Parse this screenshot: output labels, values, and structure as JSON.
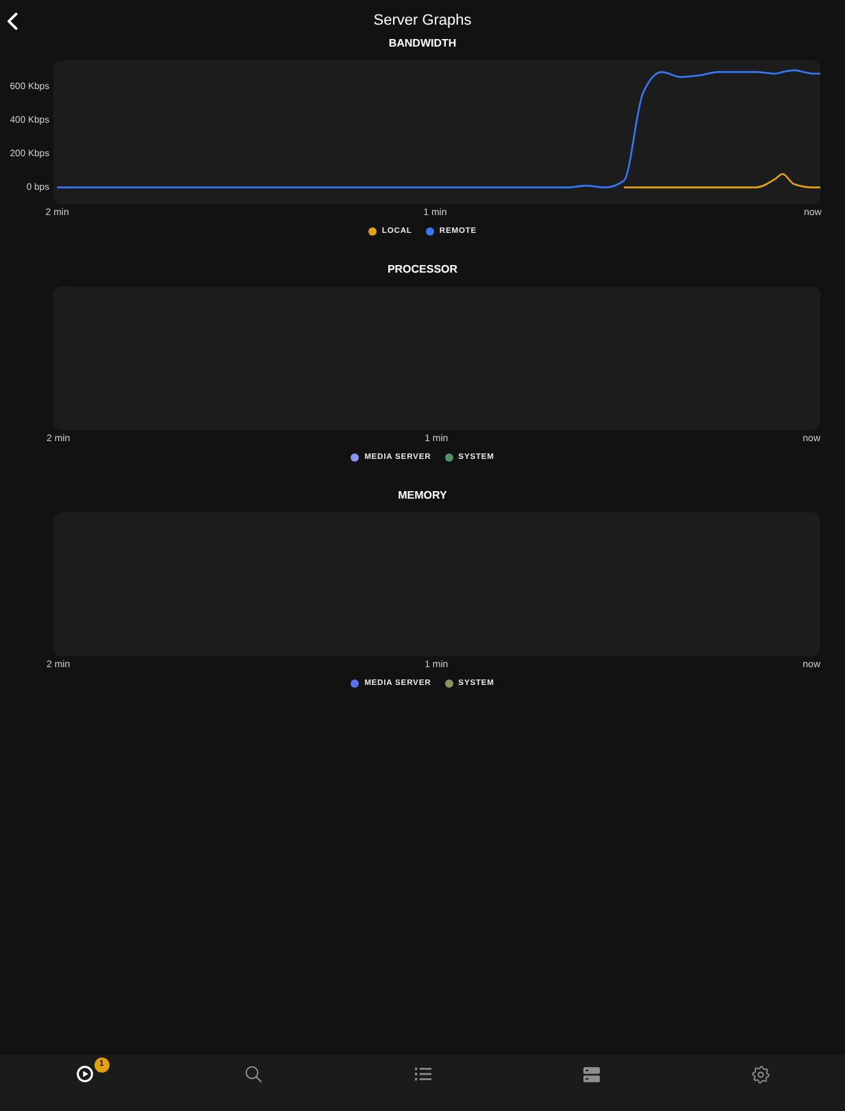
{
  "header": {
    "title": "Server Graphs"
  },
  "sections": [
    {
      "kind": "line_chart",
      "title": "BANDWIDTH",
      "chart_data": {
        "type": "line",
        "x": [
          2,
          1.95,
          1.9,
          1.85,
          1.8,
          1.75,
          1.7,
          1.65,
          1.6,
          1.55,
          1.5,
          1.45,
          1.4,
          1.35,
          1.3,
          1.25,
          1.2,
          1.15,
          1.1,
          1.05,
          1,
          0.95,
          0.9,
          0.85,
          0.8,
          0.75,
          0.7,
          0.65,
          0.6,
          0.55,
          0.5,
          0.45,
          0.4,
          0.35,
          0.3,
          0.25,
          0.2,
          0.15,
          0.1,
          0.08,
          0.05,
          0,
          -0.02
        ],
        "xlim": [
          2.01,
          -0.02
        ],
        "ylim": [
          -100,
          760
        ],
        "xticks": [
          {
            "value": 2,
            "label": "2 min"
          },
          {
            "value": 1,
            "label": "1 min"
          },
          {
            "value": 0,
            "label": "now"
          }
        ],
        "yticks": [
          {
            "value": 0,
            "label": "0 bps"
          },
          {
            "value": 200,
            "label": "200 Kbps"
          },
          {
            "value": 400,
            "label": "400 Kbps"
          },
          {
            "value": 600,
            "label": "600 Kbps"
          }
        ],
        "legend": "bottom",
        "series": [
          {
            "name": "LOCAL",
            "color": "#e5a00d",
            "values": [
              null,
              null,
              null,
              null,
              null,
              null,
              null,
              null,
              null,
              null,
              null,
              null,
              null,
              null,
              null,
              null,
              null,
              null,
              null,
              null,
              null,
              null,
              null,
              null,
              null,
              null,
              null,
              null,
              null,
              null,
              0,
              0,
              0,
              0,
              0,
              0,
              0,
              0,
              50,
              80,
              20,
              0,
              0
            ]
          },
          {
            "name": "REMOTE",
            "color": "#3478f6",
            "values": [
              0,
              0,
              0,
              0,
              0,
              0,
              0,
              0,
              0,
              0,
              0,
              0,
              0,
              0,
              0,
              0,
              0,
              0,
              0,
              0,
              0,
              0,
              0,
              0,
              0,
              0,
              0,
              0,
              10,
              0,
              40,
              560,
              690,
              660,
              670,
              690,
              690,
              690,
              680,
              690,
              700,
              680,
              680
            ]
          }
        ]
      }
    },
    {
      "kind": "empty_chart",
      "title": "PROCESSOR",
      "x_labels": [
        "2 min",
        "1 min",
        "now"
      ],
      "legend": [
        {
          "label": "MEDIA SERVER",
          "color": "#8b93f3"
        },
        {
          "label": "SYSTEM",
          "color": "#4f9466"
        }
      ]
    },
    {
      "kind": "empty_chart",
      "title": "MEMORY",
      "x_labels": [
        "2 min",
        "1 min",
        "now"
      ],
      "legend": [
        {
          "label": "MEDIA SERVER",
          "color": "#5a72ee"
        },
        {
          "label": "SYSTEM",
          "color": "#8e9165"
        }
      ]
    }
  ],
  "tab_bar": [
    {
      "kind": "play",
      "selected": true,
      "badge": "1"
    },
    {
      "kind": "search",
      "selected": false
    },
    {
      "kind": "list",
      "selected": false
    },
    {
      "kind": "server",
      "selected": false
    },
    {
      "kind": "settings",
      "selected": false
    }
  ]
}
